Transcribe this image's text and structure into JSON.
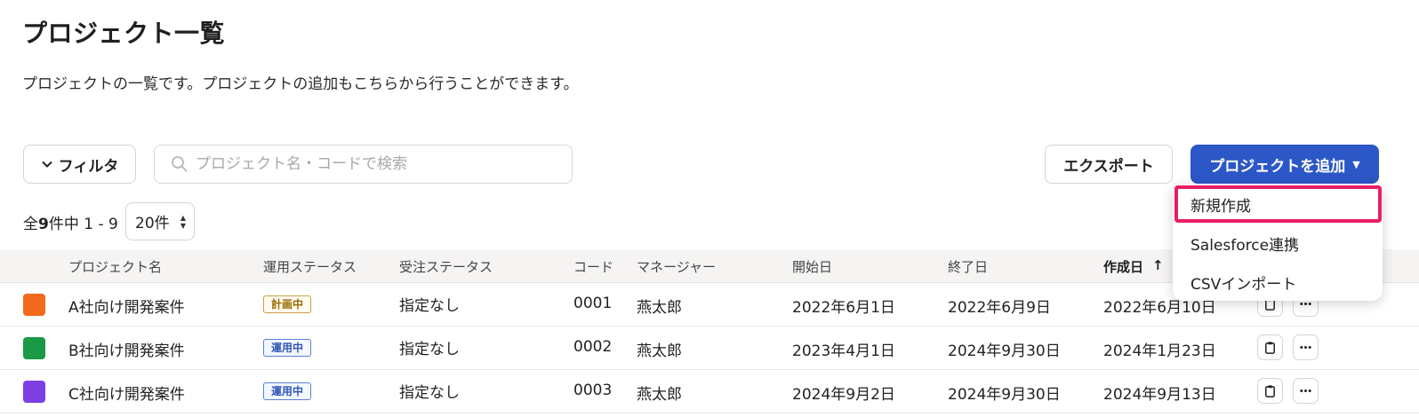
{
  "page": {
    "title": "プロジェクト一覧",
    "description": "プロジェクトの一覧です。プロジェクトの追加もこちらから行うことができます。"
  },
  "toolbar": {
    "filter_label": "フィルタ",
    "search_placeholder": "プロジェクト名・コードで検索",
    "export_label": "エクスポート",
    "add_label": "プロジェクトを追加"
  },
  "pagination": {
    "prefix": "全",
    "total": "9",
    "suffix": "件中 1 - 9",
    "page_size": "20件"
  },
  "table": {
    "columns": [
      "プロジェクト名",
      "運用ステータス",
      "受注ステータス",
      "コード",
      "マネージャー",
      "開始日",
      "終了日",
      "作成日"
    ],
    "sort_indicator": "↑",
    "rows": [
      {
        "color": "#f26a1b",
        "name": "A社向け開発案件",
        "op_status": "計画中",
        "op_kind": "planning",
        "order_status": "指定なし",
        "code": "0001",
        "manager": "燕太郎",
        "start": "2022年6月1日",
        "end": "2022年6月9日",
        "created": "2022年6月10日"
      },
      {
        "color": "#1a9a46",
        "name": "B社向け開発案件",
        "op_status": "運用中",
        "op_kind": "running",
        "order_status": "指定なし",
        "code": "0002",
        "manager": "燕太郎",
        "start": "2023年4月1日",
        "end": "2024年9月30日",
        "created": "2024年1月23日"
      },
      {
        "color": "#7b3fe4",
        "name": "C社向け開発案件",
        "op_status": "運用中",
        "op_kind": "running",
        "order_status": "指定なし",
        "code": "0003",
        "manager": "燕太郎",
        "start": "2024年9月2日",
        "end": "2024年9月30日",
        "created": "2024年9月13日"
      }
    ]
  },
  "add_menu": {
    "items": [
      "新規作成",
      "Salesforce連携",
      "CSVインポート"
    ],
    "highlighted_index": 0
  },
  "colors": {
    "primary": "#2c57c6",
    "highlight": "#ea1e63"
  }
}
